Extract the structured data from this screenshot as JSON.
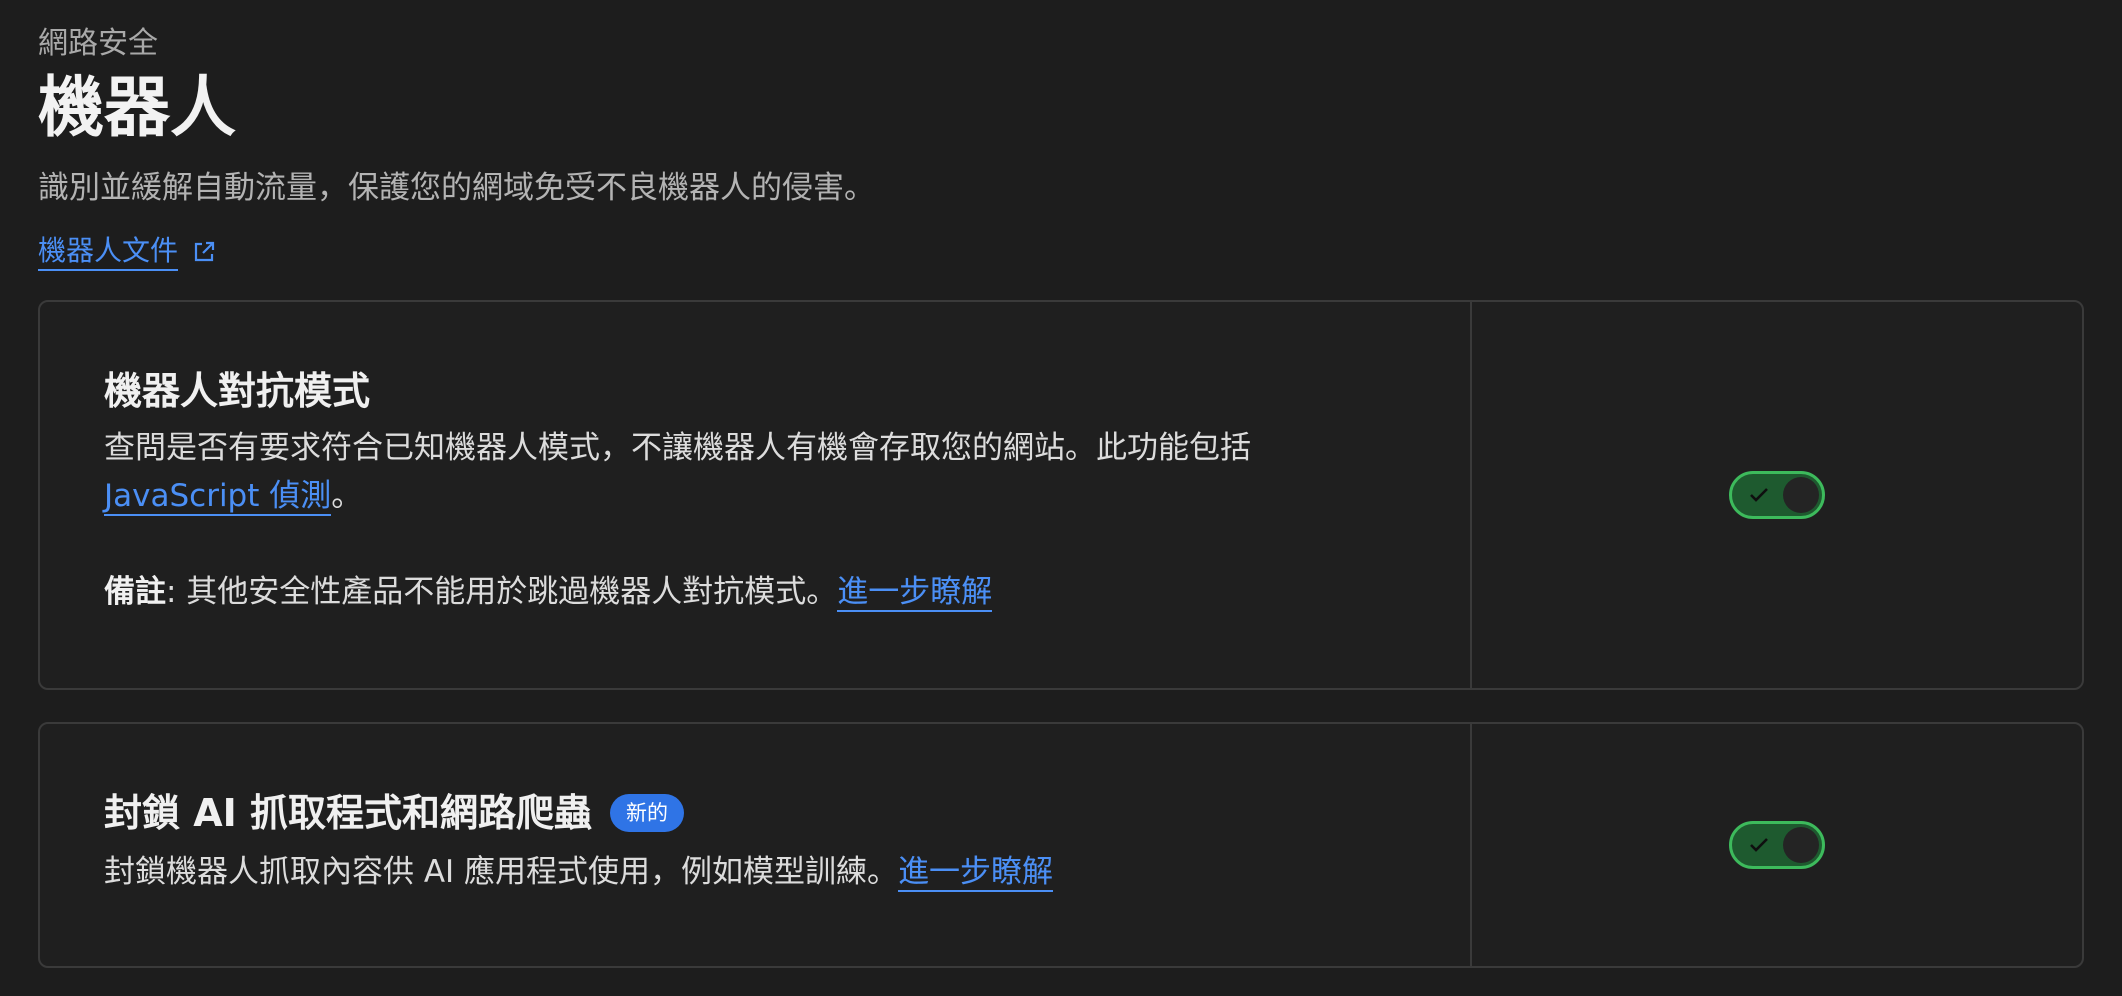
{
  "header": {
    "breadcrumb": "網路安全",
    "title": "機器人",
    "description": "識別並緩解自動流量，保護您的網域免受不良機器人的侵害。",
    "doc_link": "機器人文件"
  },
  "cards": [
    {
      "title": "機器人對抗模式",
      "text_part1": "查問是否有要求符合已知機器人模式，不讓機器人有機會存取您的網站。此功能包括",
      "js_link": "JavaScript 偵測",
      "text_part2": "。",
      "note_label": "備註",
      "note_text": ": 其他安全性產品不能用於跳過機器人對抗模式。",
      "learn_more": "進一步瞭解",
      "toggle_on": true
    },
    {
      "title": "封鎖 AI 抓取程式和網路爬蟲",
      "badge": "新的",
      "text": "封鎖機器人抓取內容供 AI 應用程式使用，例如模型訓練。",
      "learn_more": "進一步瞭解",
      "toggle_on": true
    }
  ],
  "colors": {
    "background": "#1d1d1d",
    "link": "#4b8ff5",
    "toggle_on": "#3dba5c",
    "badge": "#2f74e6"
  },
  "icons": [
    "external-link-icon",
    "check-icon"
  ]
}
